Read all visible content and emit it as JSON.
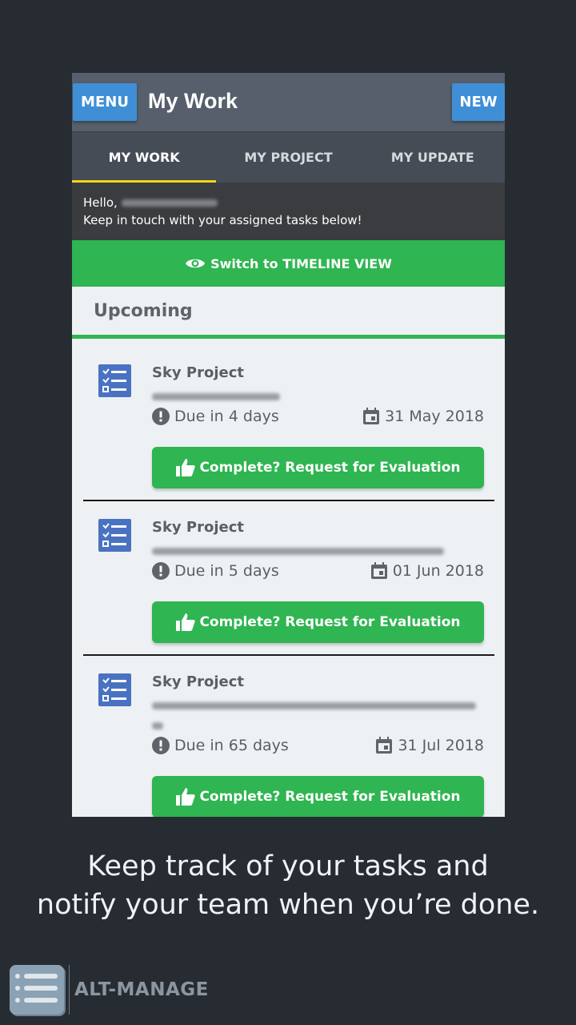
{
  "app": {
    "title": "My Work",
    "menu_label": "MENU",
    "new_label": "NEW"
  },
  "tabs": [
    {
      "label": "MY WORK",
      "active": true
    },
    {
      "label": "MY PROJECT",
      "active": false
    },
    {
      "label": "MY UPDATE",
      "active": false
    }
  ],
  "greeting": {
    "hello": "Hello,",
    "message": "Keep in touch with your assigned tasks below!"
  },
  "switch_label": "Switch to TIMELINE VIEW",
  "section_title": "Upcoming",
  "tasks": [
    {
      "project": "Sky Project",
      "due": "Due in 4 days",
      "date": "31 May 2018",
      "action": "Complete? Request for Evaluation"
    },
    {
      "project": "Sky Project",
      "due": "Due in 5 days",
      "date": "01 Jun 2018",
      "action": "Complete? Request for Evaluation"
    },
    {
      "project": "Sky Project",
      "due": "Due in 65 days",
      "date": "31 Jul 2018",
      "action": "Complete? Request for Evaluation"
    }
  ],
  "caption": {
    "line1": "Keep track of your tasks and",
    "line2": "notify your team when you’re done."
  },
  "brand": "ALT-MANAGE",
  "colors": {
    "accent_green": "#2fb551",
    "button_blue": "#3f8fd6",
    "tab_indicator": "#f2d51c",
    "background": "#272c33"
  }
}
